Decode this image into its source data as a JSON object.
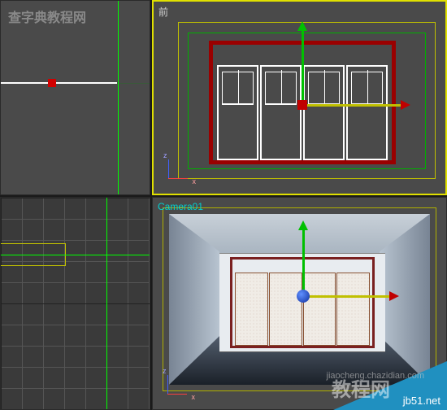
{
  "viewports": {
    "top_left": {
      "label": ""
    },
    "top_right": {
      "label": "前"
    },
    "bottom_left": {
      "label": ""
    },
    "bottom_right": {
      "label": "Camera01"
    }
  },
  "axes": {
    "z": "z",
    "x": "x"
  },
  "gizmo": {
    "x_axis_color": "#c0c000",
    "y_axis_color": "#00c000",
    "center_color": "#c00000"
  },
  "watermark": {
    "top_left": "查字典教程网",
    "bottom_right": "教程网",
    "url": "jiaocheng.chazidian.com",
    "corner": "jb51.net"
  },
  "scene": {
    "door_frame_color": "#9a0000",
    "door_panel_count": 4
  }
}
